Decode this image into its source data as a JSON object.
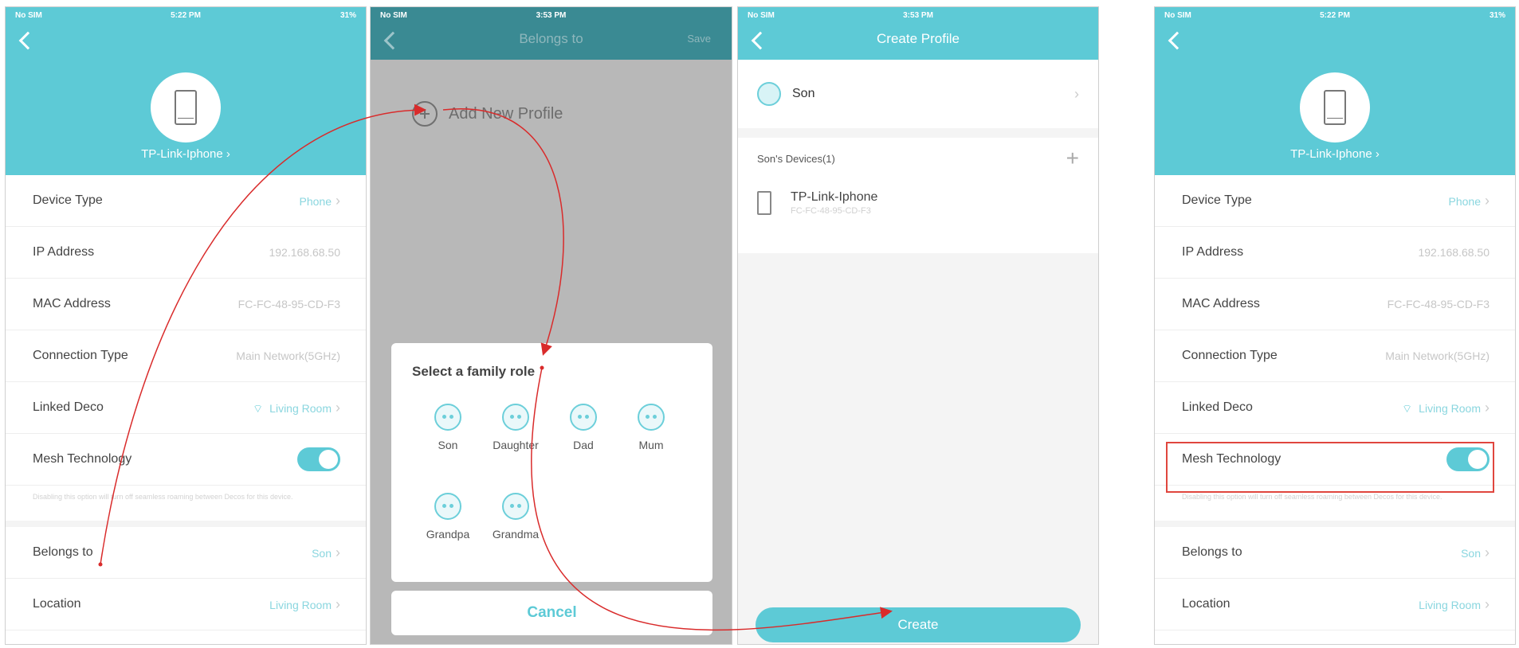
{
  "status_bar": {
    "screen1": {
      "carrier": "No SIM",
      "time": "5:22 PM",
      "battery": "31%"
    },
    "screen2": {
      "carrier": "No SIM",
      "time": "3:53 PM",
      "battery": ""
    },
    "screen3": {
      "carrier": "No SIM",
      "time": "3:53 PM",
      "battery": ""
    },
    "screen4": {
      "carrier": "No SIM",
      "time": "5:22 PM",
      "battery": "31%"
    }
  },
  "device_screen": {
    "device_name": "TP-Link-Iphone ›",
    "rows": [
      {
        "label": "Device Type",
        "value": "Phone"
      },
      {
        "label": "IP Address",
        "value": "192.168.68.50"
      },
      {
        "label": "MAC Address",
        "value": "FC-FC-48-95-CD-F3"
      },
      {
        "label": "Connection Type",
        "value": "Main Network(5GHz)"
      },
      {
        "label": "Linked Deco",
        "value": "Living Room"
      },
      {
        "label": "Mesh Technology"
      }
    ],
    "hint": "Disabling this option will turn off seamless roaming between Decos for this device.",
    "belongs_to": {
      "label": "Belongs to",
      "value": "Son"
    },
    "location": {
      "label": "Location",
      "value": "Living Room"
    }
  },
  "belongs_screen": {
    "title": "Belongs to",
    "right_action": "Save",
    "add_profile": "Add New Profile",
    "sheet_title": "Select a family role",
    "roles": [
      "Son",
      "Daughter",
      "Dad",
      "Mum",
      "Grandpa",
      "Grandma"
    ],
    "cancel": "Cancel"
  },
  "create_screen": {
    "title": "Create Profile",
    "profile_name": "Son",
    "devices_header": "Son's Devices(1)",
    "device_name": "TP-Link-Iphone",
    "device_mac": "FC-FC-48-95-CD-F3",
    "create_label": "Create"
  },
  "colors": {
    "accent": "#5dcad6",
    "arrow": "#d92b2b",
    "highlight": "#e0463e"
  }
}
